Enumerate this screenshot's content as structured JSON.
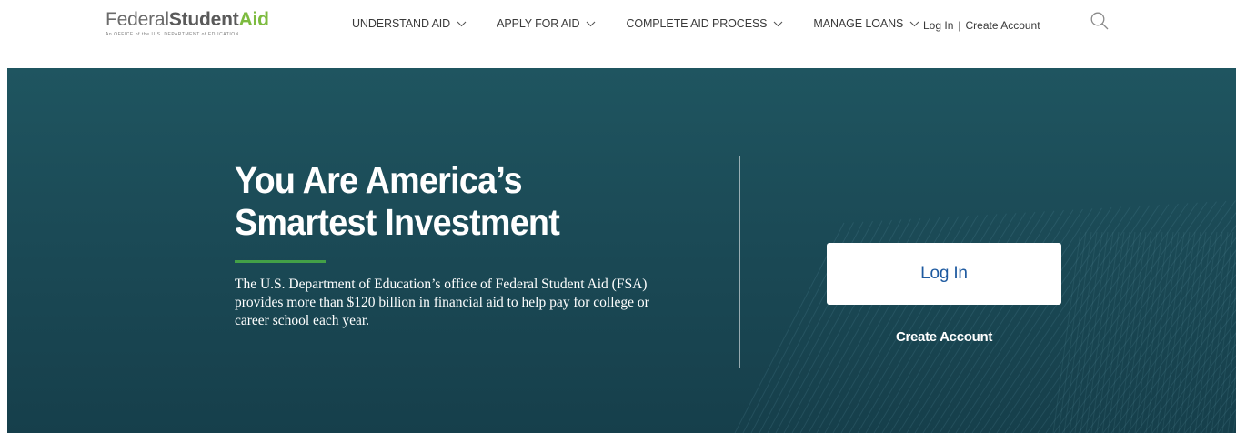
{
  "header": {
    "logo": {
      "federal": "Federal",
      "student": "Student",
      "aid": "Aid",
      "tagline": "An OFFICE of the U.S. DEPARTMENT of EDUCATION"
    },
    "nav": [
      {
        "label": "UNDERSTAND AID"
      },
      {
        "label": "APPLY FOR AID"
      },
      {
        "label": "COMPLETE AID PROCESS"
      },
      {
        "label": "MANAGE LOANS"
      }
    ],
    "log_in": "Log In",
    "separator": "|",
    "create_account": "Create Account",
    "search_icon": "search-icon"
  },
  "hero": {
    "title_line1": "You Are America’s",
    "title_line2": "Smartest Investment",
    "description": "The U.S. Department of Education’s office of Federal Student Aid (FSA) provides more than $120 billion in financial aid to help pay for college or career school each year.",
    "login_button": "Log In",
    "create_account": "Create Account"
  },
  "colors": {
    "hero_bg": "#1b4a56",
    "accent_green": "#43a047",
    "logo_green": "#7dbb3f",
    "login_text": "#1e5aa0"
  }
}
